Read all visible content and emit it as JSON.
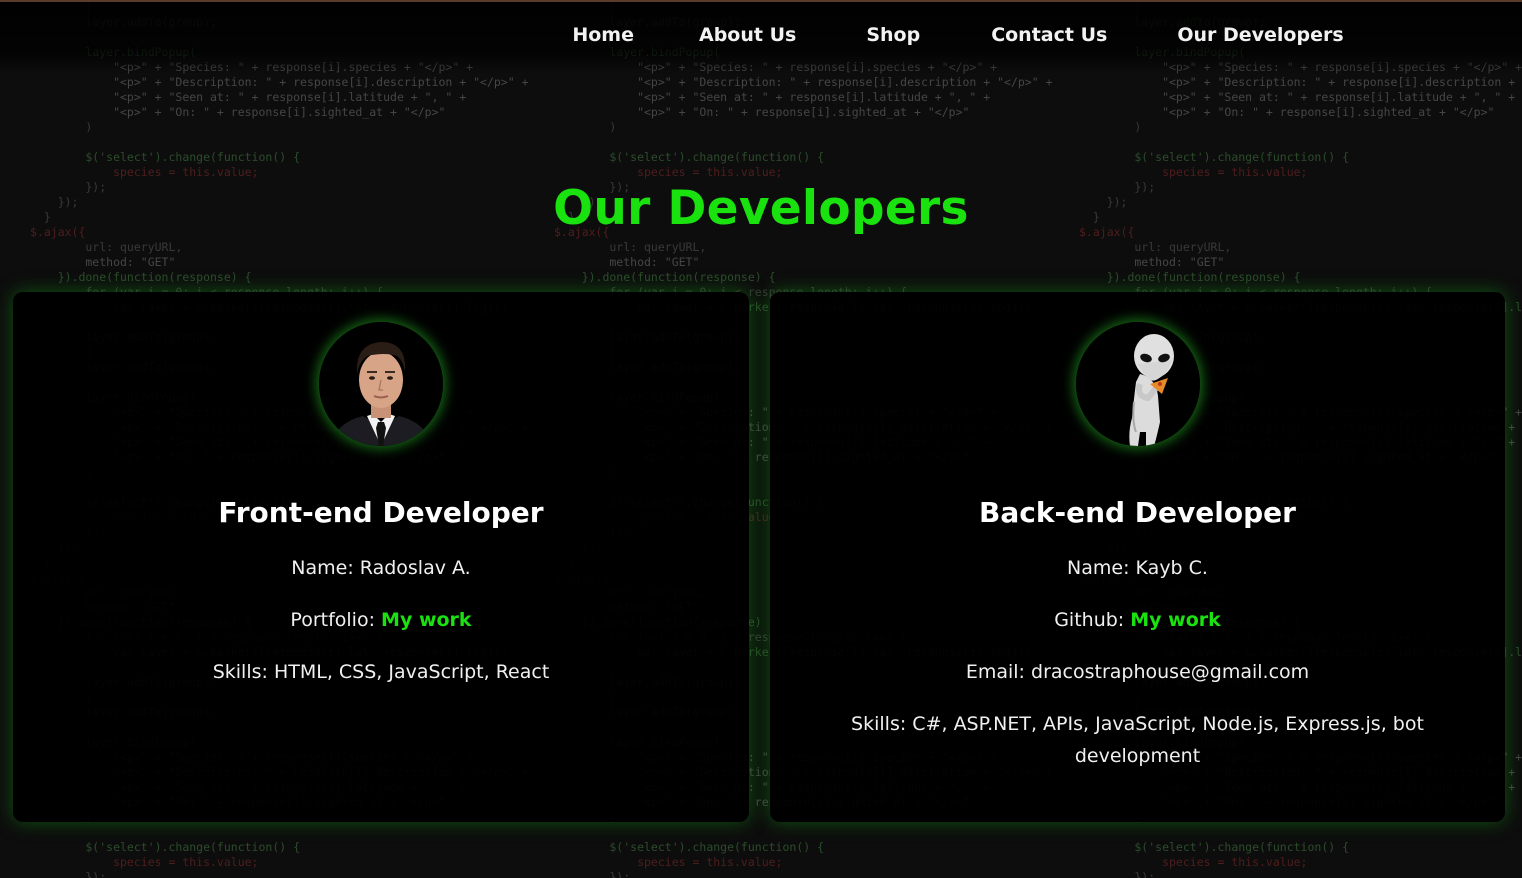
{
  "nav": {
    "items": [
      "Home",
      "About Us",
      "Shop",
      "Contact Us",
      "Our Developers"
    ]
  },
  "page_title": "Our Developers",
  "developers": [
    {
      "role": "Front-end Developer",
      "name_label": "Name:",
      "name": "Radoslav A.",
      "link_label": "Portfolio:",
      "link_text": "My work",
      "skills_label": "Skills:",
      "skills": "HTML, CSS, JavaScript, React",
      "avatar": "man-in-suit-avatar"
    },
    {
      "role": "Back-end Developer",
      "name_label": "Name:",
      "name": "Kayb C.",
      "link_label": "Github:",
      "link_text": "My work",
      "email_label": "Email:",
      "email": "dracostraphouse@gmail.com",
      "skills_label": "Skills:",
      "skills": "C#, ASP.NET, APIs, JavaScript, Node.js, Express.js, bot development",
      "avatar": "alien-avatar"
    }
  ],
  "colors": {
    "accent": "#19e20f",
    "background": "#0d0d0d",
    "card": "#000000"
  }
}
